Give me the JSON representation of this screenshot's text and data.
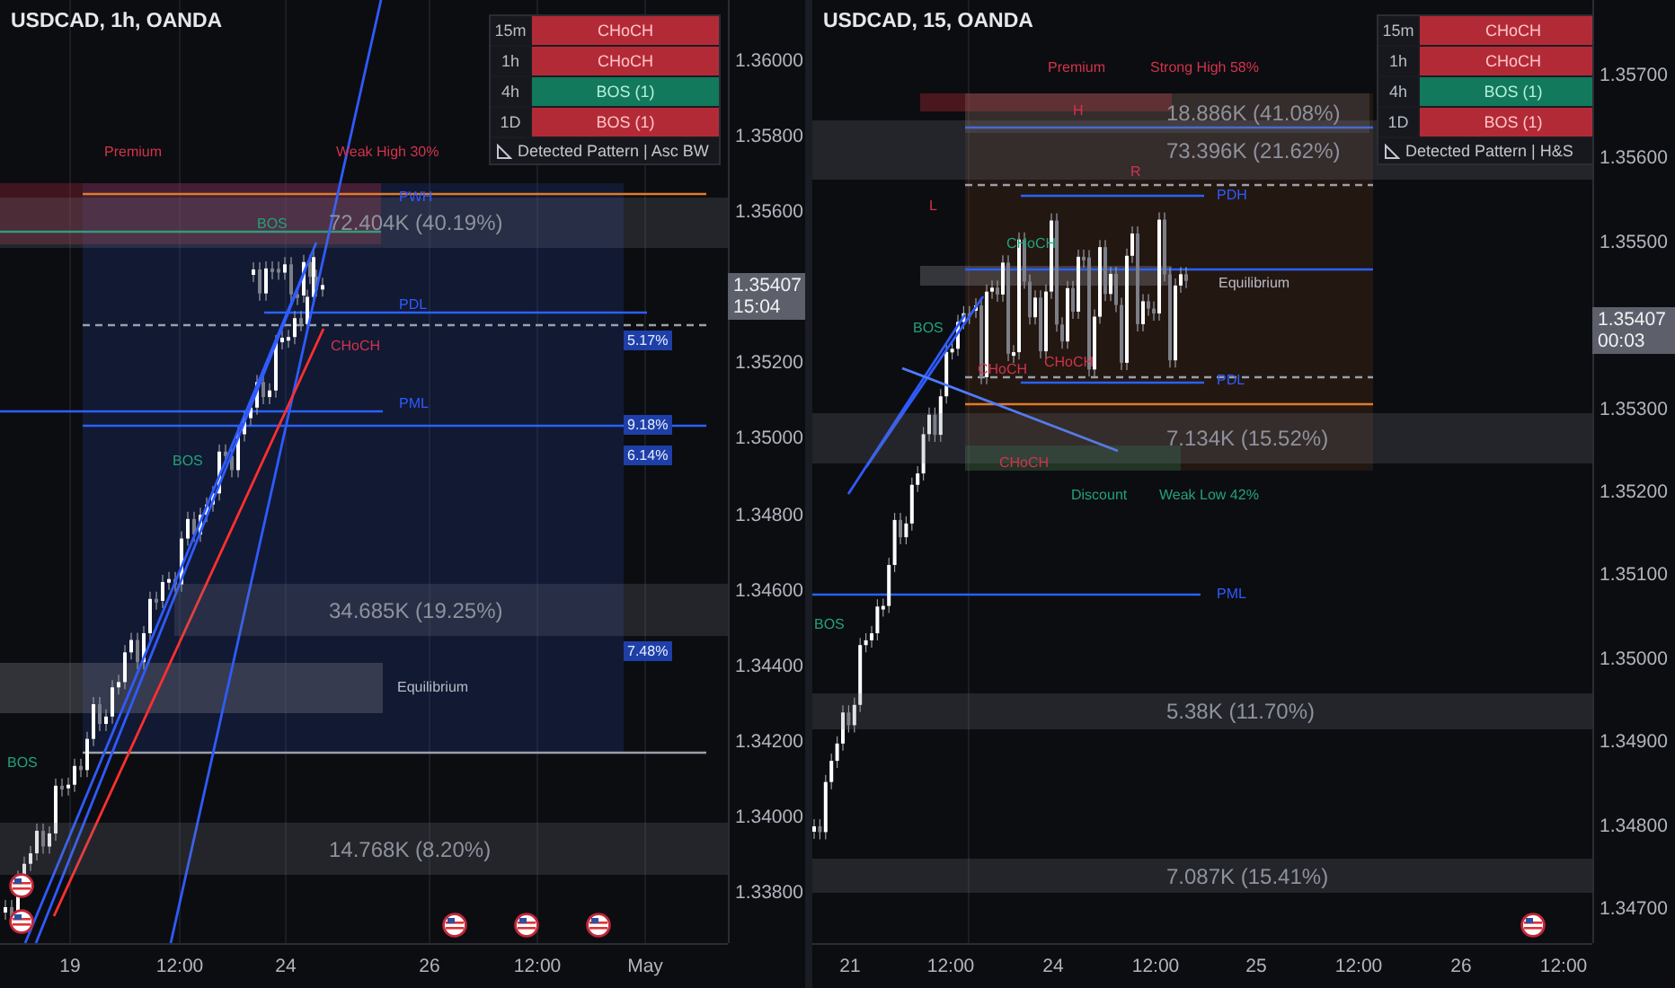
{
  "panes": [
    {
      "title": "USDCAD, 1h, OANDA",
      "price_axis": [
        "1.36000",
        "1.35800",
        "1.35600",
        "1.35200",
        "1.35000",
        "1.34800",
        "1.34600",
        "1.34400",
        "1.34200",
        "1.34000",
        "1.33800"
      ],
      "current_price": {
        "price": "1.35407",
        "countdown": "15:04"
      },
      "time_axis": [
        "19",
        "12:00",
        "24",
        "26",
        "12:00",
        "May"
      ],
      "pattern_table": {
        "rows": [
          {
            "timeframe": "15m",
            "signal": "CHoCH",
            "kind": "bearish"
          },
          {
            "timeframe": "1h",
            "signal": "CHoCH",
            "kind": "bearish"
          },
          {
            "timeframe": "4h",
            "signal": "BOS (1)",
            "kind": "bullish"
          },
          {
            "timeframe": "1D",
            "signal": "BOS (1)",
            "kind": "bearish"
          }
        ],
        "pattern": "Detected Pattern | Asc BW"
      },
      "volume_zones": [
        "72.404K (40.19%)",
        "34.685K (19.25%)",
        "14.768K (8.20%)"
      ],
      "labels": [
        {
          "text": "Premium",
          "kind": "bearish"
        },
        {
          "text": "Weak High 30%",
          "kind": "bearish"
        },
        {
          "text": "PWH",
          "kind": "level"
        },
        {
          "text": "BOS",
          "kind": "bullish"
        },
        {
          "text": "PDL",
          "kind": "level"
        },
        {
          "text": "CHoCH",
          "kind": "bearish"
        },
        {
          "text": "PML",
          "kind": "level"
        },
        {
          "text": "BOS",
          "kind": "bullish"
        },
        {
          "text": "Equilibrium",
          "kind": "neutral"
        },
        {
          "text": "BOS",
          "kind": "bullish"
        }
      ],
      "tags": [
        "5.17%",
        "9.18%",
        "6.14%",
        "7.48%"
      ]
    },
    {
      "title": "USDCAD, 15, OANDA",
      "price_axis": [
        "1.35700",
        "1.35600",
        "1.35500",
        "1.35300",
        "1.35200",
        "1.35100",
        "1.35000",
        "1.34900",
        "1.34800",
        "1.34700"
      ],
      "current_price": {
        "price": "1.35407",
        "countdown": "00:03"
      },
      "time_axis": [
        "21",
        "12:00",
        "24",
        "12:00",
        "25",
        "12:00",
        "26",
        "12:00"
      ],
      "pattern_table": {
        "rows": [
          {
            "timeframe": "15m",
            "signal": "CHoCH",
            "kind": "bearish"
          },
          {
            "timeframe": "1h",
            "signal": "CHoCH",
            "kind": "bearish"
          },
          {
            "timeframe": "4h",
            "signal": "BOS (1)",
            "kind": "bullish"
          },
          {
            "timeframe": "1D",
            "signal": "BOS (1)",
            "kind": "bearish"
          }
        ],
        "pattern": "Detected Pattern | H&S"
      },
      "volume_zones": [
        "18.886K (41.08%)",
        "73.396K (21.62%)",
        "7.134K (15.52%)",
        "5.38K (11.70%)",
        "7.087K (15.41%)"
      ],
      "labels": [
        {
          "text": "Premium",
          "kind": "bearish"
        },
        {
          "text": "Strong High 58%",
          "kind": "bearish"
        },
        {
          "text": "H",
          "kind": "bearish"
        },
        {
          "text": "R",
          "kind": "bearish"
        },
        {
          "text": "PDH",
          "kind": "level"
        },
        {
          "text": "L",
          "kind": "bearish"
        },
        {
          "text": "CHoCH",
          "kind": "bullish"
        },
        {
          "text": "Equilibrium",
          "kind": "neutral"
        },
        {
          "text": "BOS",
          "kind": "bullish"
        },
        {
          "text": "CHoCH",
          "kind": "bearish"
        },
        {
          "text": "CHoCH",
          "kind": "bearish"
        },
        {
          "text": "PDL",
          "kind": "level"
        },
        {
          "text": "CHoCH",
          "kind": "bearish"
        },
        {
          "text": "Discount",
          "kind": "bullish"
        },
        {
          "text": "Weak Low 42%",
          "kind": "bullish"
        },
        {
          "text": "PML",
          "kind": "level"
        },
        {
          "text": "BOS",
          "kind": "bullish"
        }
      ]
    }
  ]
}
